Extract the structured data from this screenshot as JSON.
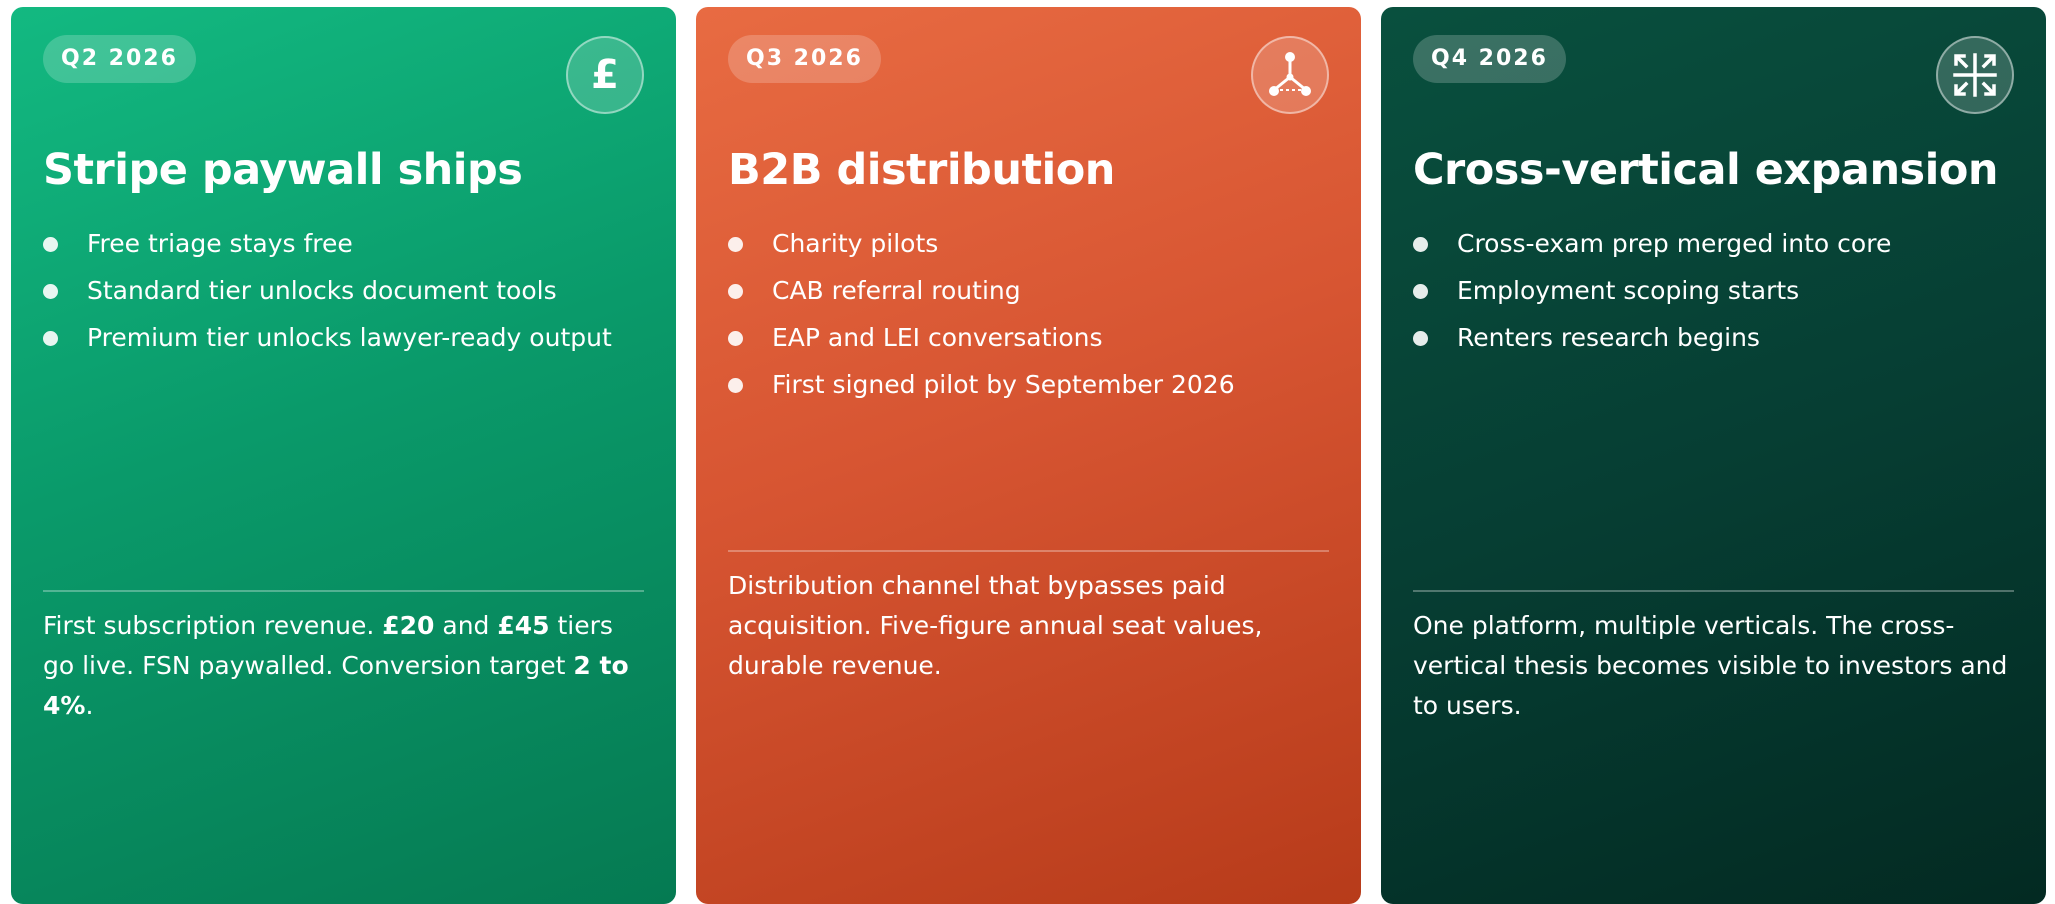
{
  "cards": [
    {
      "period": "Q2 2026",
      "icon": "pound-sign-icon",
      "icon_glyph": "£",
      "title": "Stripe paywall ships",
      "bullets": [
        "Free triage stays free",
        "Standard tier unlocks document tools",
        "Premium tier unlocks lawyer-ready output"
      ],
      "footer": {
        "t1": "First subscription revenue. ",
        "b1": "£20",
        "t2": " and ",
        "b2": "£45",
        "t3": " tiers go live. FSN paywalled. Conversion target ",
        "b3": "2 to 4%",
        "t4": "."
      }
    },
    {
      "period": "Q3 2026",
      "icon": "network-nodes-icon",
      "title": "B2B distribution",
      "bullets": [
        "Charity pilots",
        "CAB referral routing",
        "EAP and LEI conversations",
        "First signed pilot by September 2026"
      ],
      "footer": {
        "text": "Distribution channel that bypasses paid acquisition. Five-figure annual seat values, durable revenue."
      }
    },
    {
      "period": "Q4 2026",
      "icon": "expand-arrows-icon",
      "title": "Cross-vertical expansion",
      "bullets": [
        "Cross-exam prep merged into core",
        "Employment scoping starts",
        "Renters research begins"
      ],
      "footer": {
        "text": "One platform, multiple verticals. The cross-vertical thesis becomes visible to investors and to users."
      }
    }
  ],
  "colors": {
    "q2_card": "#0a9a6a",
    "q3_card": "#d75532",
    "q4_card": "#063e33",
    "text": "#ffffff"
  }
}
